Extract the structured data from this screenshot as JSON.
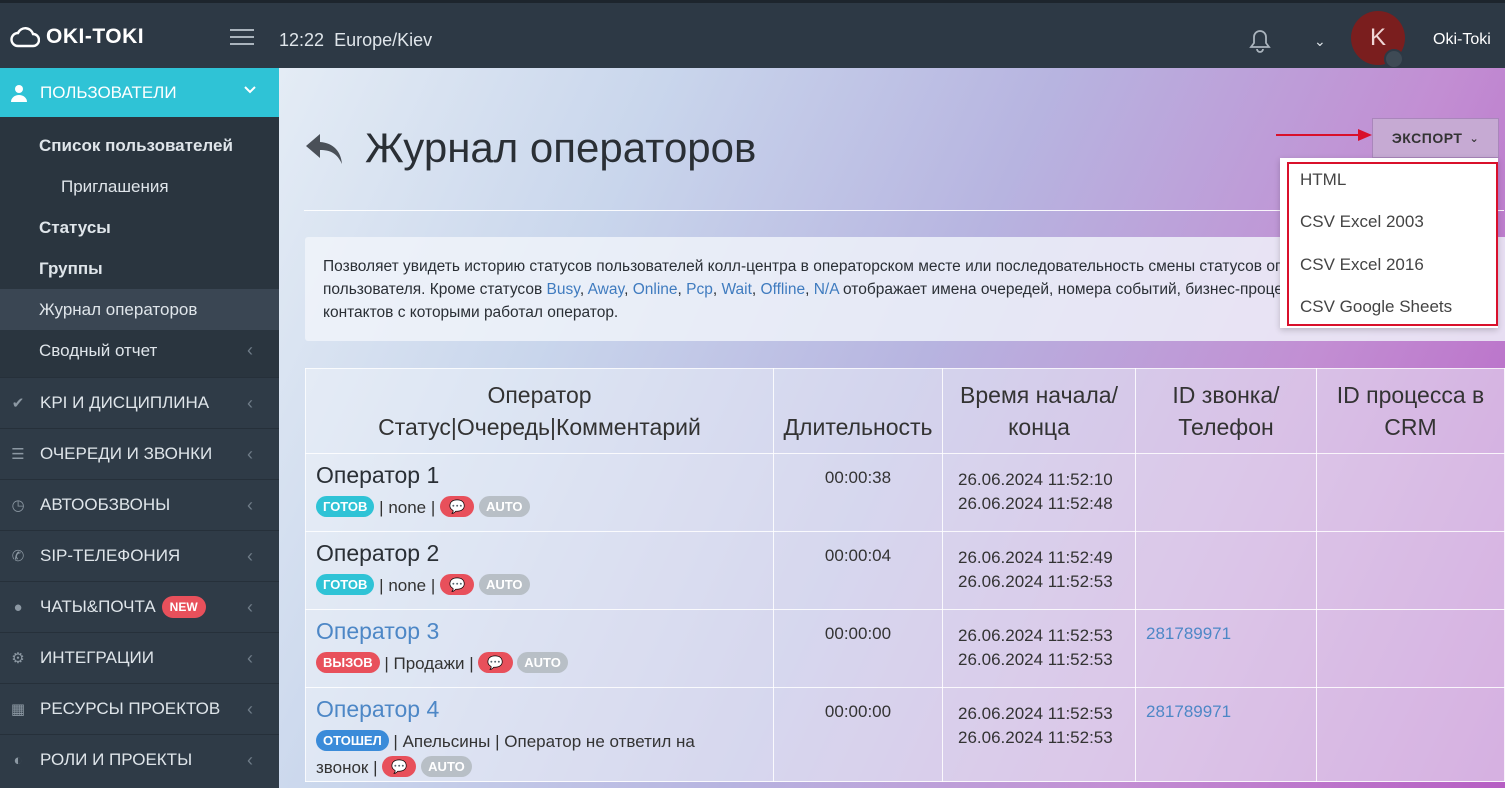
{
  "app": {
    "logo_text": "OKI-TOKI",
    "time": "12:22",
    "timezone": "Europe/Kiev",
    "user_initial": "K",
    "user_name": "Oki-Toki"
  },
  "sidebar": {
    "header": "ПОЛЬЗОВАТЕЛИ",
    "subitems": [
      {
        "label": "Список пользователей"
      },
      {
        "label": "Приглашения"
      },
      {
        "label": "Статусы"
      },
      {
        "label": "Группы"
      },
      {
        "label": "Журнал операторов"
      },
      {
        "label": "Сводный отчет"
      }
    ],
    "items": [
      {
        "label": "KPI И ДИСЦИПЛИНА",
        "icon": "check-icon"
      },
      {
        "label": "ОЧЕРЕДИ И ЗВОНКИ",
        "icon": "list-icon"
      },
      {
        "label": "АВТООБЗВОНЫ",
        "icon": "clock-icon"
      },
      {
        "label": "SIP-ТЕЛЕФОНИЯ",
        "icon": "phone-icon"
      },
      {
        "label": "ЧАТЫ&ПОЧТА",
        "icon": "chat-icon",
        "badge": "NEW"
      },
      {
        "label": "ИНТЕГРАЦИИ",
        "icon": "gears-icon"
      },
      {
        "label": "РЕСУРСЫ ПРОЕКТОВ",
        "icon": "grid-icon"
      },
      {
        "label": "РОЛИ И ПРОЕКТЫ",
        "icon": "toggle-icon"
      }
    ]
  },
  "page": {
    "title": "Журнал операторов",
    "export_label": "ЭКСПОРТ",
    "export_options": [
      "HTML",
      "CSV Excel 2003",
      "CSV Excel 2016",
      "CSV Google Sheets"
    ],
    "info": {
      "text1": "Позволяет увидеть историю статусов пользователей колл-центра в операторском месте или последовательность смены статусов определенного",
      "text2": "пользователя. Кроме статусов ",
      "statuses": [
        "Busy",
        "Away",
        "Online",
        "Pcp",
        "Wait",
        "Offline",
        "N/A"
      ],
      "text3": " отображает имена очередей, номера событий, бизнес-процессов и",
      "text4": "контактов с которыми работал оператор."
    }
  },
  "table": {
    "headers": {
      "operator": "Оператор",
      "operator_sub": "Статус|Очередь|Комментарий",
      "duration": "Длительность",
      "time_1": "Время начала/",
      "time_2": "конца",
      "call_1": "ID звонка/",
      "call_2": "Телефон",
      "crm_1": "ID процесса в",
      "crm_2": "CRM"
    },
    "rows": [
      {
        "name": "Оператор 1",
        "status": "ГОТОВ",
        "queue": "none",
        "comment": "",
        "duration": "00:00:38",
        "start": "26.06.2024 11:52:10",
        "end": "26.06.2024 11:52:48",
        "call_id": ""
      },
      {
        "name": "Оператор 2",
        "status": "ГОТОВ",
        "queue": "none",
        "comment": "",
        "duration": "00:00:04",
        "start": "26.06.2024 11:52:49",
        "end": "26.06.2024 11:52:53",
        "call_id": ""
      },
      {
        "name": "Оператор 3",
        "status": "ВЫЗОВ",
        "queue": "Продажи",
        "comment": "",
        "duration": "00:00:00",
        "start": "26.06.2024 11:52:53",
        "end": "26.06.2024 11:52:53",
        "call_id": "281789971"
      },
      {
        "name": "Оператор 4",
        "status": "ОТОШЕЛ",
        "queue": "Апельсины",
        "comment": "Оператор не ответил на",
        "comment2": "звонок",
        "duration": "00:00:00",
        "start": "26.06.2024 11:52:53",
        "end": "26.06.2024 11:52:53",
        "call_id": "281789971"
      }
    ],
    "auto_label": "AUTO"
  },
  "colors": {
    "accent": "#2fc3d6",
    "danger": "#e8505b",
    "link": "#4d87c6",
    "highlight": "#d9102b"
  }
}
